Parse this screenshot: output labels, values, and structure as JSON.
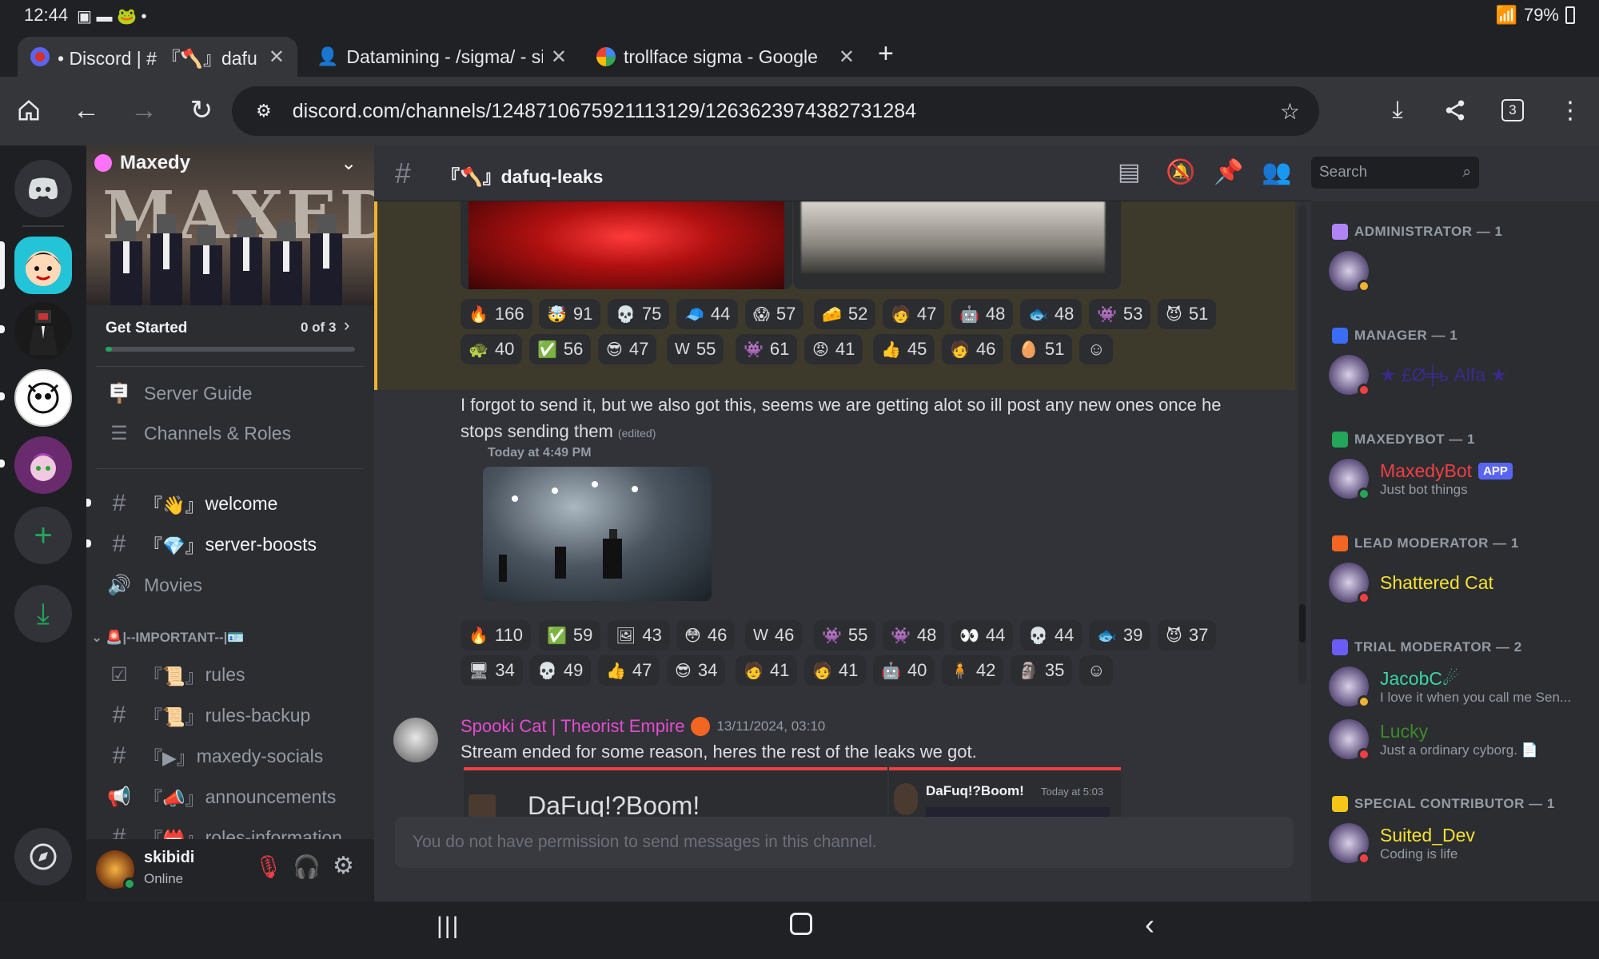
{
  "status_bar": {
    "time": "12:44",
    "battery": "79%"
  },
  "tabs": [
    {
      "title": "• Discord | # 『🪓』dafuq",
      "active": true
    },
    {
      "title": "Datamining - /sigma/ - si",
      "active": false
    },
    {
      "title": "trollface sigma - Google S",
      "active": false
    }
  ],
  "omnibox": {
    "url": "discord.com/channels/1248710675921113129/1263623974382731284",
    "tab_count": "3"
  },
  "server": {
    "name": "Maxedy",
    "banner_text": "MAXEDY",
    "get_started": {
      "label": "Get Started",
      "progress_text": "0 of 3",
      "progress": 0
    }
  },
  "channels": {
    "top_items": [
      {
        "label": "Server Guide"
      },
      {
        "label": "Channels & Roles"
      }
    ],
    "list": [
      {
        "prefix": "『👋』",
        "name": "welcome",
        "bright": true,
        "unread": true
      },
      {
        "prefix": "『💎』",
        "name": "server-boosts",
        "bright": true,
        "unread": true
      },
      {
        "prefix": "",
        "name": "Movies",
        "bright": false,
        "voice": true
      }
    ],
    "category": "🚨|--IMPORTANT--|🪪",
    "category_items": [
      {
        "prefix": "『📜』",
        "name": "rules"
      },
      {
        "prefix": "『📜』",
        "name": "rules-backup"
      },
      {
        "prefix": "『▶』",
        "name": "maxedy-socials"
      },
      {
        "prefix": "『📣』",
        "name": "announcements"
      },
      {
        "prefix": "『📛』",
        "name": "roles-information"
      }
    ]
  },
  "user_panel": {
    "name": "skibidi",
    "status": "Online"
  },
  "chat_header": {
    "channel": "『🪓』dafuq-leaks",
    "search_placeholder": "Search"
  },
  "reactions_top": [
    [
      "🔥",
      "166"
    ],
    [
      "🤯",
      "91"
    ],
    [
      "💀",
      "75"
    ],
    [
      "🧢",
      "44"
    ],
    [
      "😱",
      "57"
    ],
    [
      "🧀",
      "52"
    ],
    [
      "🧑",
      "47"
    ],
    [
      "🤖",
      "48"
    ],
    [
      "🐟",
      "48"
    ],
    [
      "👾",
      "53"
    ],
    [
      "😈",
      "51"
    ],
    [
      "🐢",
      "40"
    ],
    [
      "✅",
      "56"
    ],
    [
      "😎",
      "47"
    ],
    [
      "W",
      "55"
    ],
    [
      "👾",
      "61"
    ],
    [
      "😡",
      "41"
    ],
    [
      "👍",
      "45"
    ],
    [
      "🧑",
      "46"
    ],
    [
      "🥚",
      "51"
    ]
  ],
  "message1": {
    "text": "I forgot to send it, but we also got this, seems we are getting alot so ill post any new ones once he stops sending them",
    "edited": "(edited)",
    "embed_time": "Today at 4:49 PM"
  },
  "reactions_mid": [
    [
      "🔥",
      "110"
    ],
    [
      "✅",
      "59"
    ],
    [
      "🖼",
      "43"
    ],
    [
      "😳",
      "46"
    ],
    [
      "W",
      "46"
    ],
    [
      "👾",
      "55"
    ],
    [
      "👾",
      "48"
    ],
    [
      "👀",
      "44"
    ],
    [
      "💀",
      "44"
    ],
    [
      "🐟",
      "39"
    ],
    [
      "😈",
      "37"
    ],
    [
      "🖥",
      "34"
    ],
    [
      "💀",
      "49"
    ],
    [
      "👍",
      "47"
    ],
    [
      "😎",
      "34"
    ],
    [
      "🧑",
      "41"
    ],
    [
      "🧑",
      "41"
    ],
    [
      "🤖",
      "40"
    ],
    [
      "🧍",
      "42"
    ],
    [
      "🗿",
      "35"
    ]
  ],
  "message2": {
    "author": "Spooki Cat | Theorist Empire",
    "timestamp": "13/11/2024, 03:10",
    "text": "Stream ended for some reason, heres the rest of the leaks we got.",
    "embed_title": "DaFuq!?Boom!",
    "embed_author": "DaFuq!?Boom!",
    "embed_time": "Today at 5:03"
  },
  "composer_placeholder": "You do not have permission to send messages in this channel.",
  "members": {
    "groups": [
      {
        "role": "ADMINISTRATOR — 1",
        "color": "#b084f5",
        "members": [
          {
            "name": " ",
            "sub": "",
            "status": "#f0b232",
            "name_color": "#5b3aa8"
          }
        ]
      },
      {
        "role": "MANAGER — 1",
        "color": "#3a6cf4",
        "members": [
          {
            "name": "★ £Ø╪ь Alfa ★",
            "sub": "",
            "status": "#f23f43",
            "name_color": "#3b2a8a"
          }
        ]
      },
      {
        "role": "MAXEDYBOT — 1",
        "color": "#23a55a",
        "members": [
          {
            "name": "MaxedyBot",
            "badge": "APP",
            "sub": "Just bot things",
            "status": "#23a55a",
            "name_color": "#f23f43"
          }
        ]
      },
      {
        "role": "LEAD MODERATOR — 1",
        "color": "#f26522",
        "members": [
          {
            "name": "Shattered Cat",
            "sub": "",
            "status": "#f23f43",
            "name_color": "#f5e133"
          }
        ]
      },
      {
        "role": "TRIAL MODERATOR — 2",
        "color": "#6a5cf4",
        "members": [
          {
            "name": "JacobC☄",
            "sub": "I love it when you call me Sen...",
            "status": "#f0b232",
            "name_color": "#3bd4a5"
          },
          {
            "name": "Lucky",
            "sub": "Just a ordinary cyborg. 📄",
            "status": "#f23f43",
            "name_color": "#3c8a2a"
          }
        ]
      },
      {
        "role": "SPECIAL CONTRIBUTOR — 1",
        "color": "#f5c518",
        "members": [
          {
            "name": "Suited_Dev",
            "sub": "Coding is life",
            "status": "#f23f43",
            "name_color": "#f5e133"
          }
        ]
      }
    ]
  }
}
